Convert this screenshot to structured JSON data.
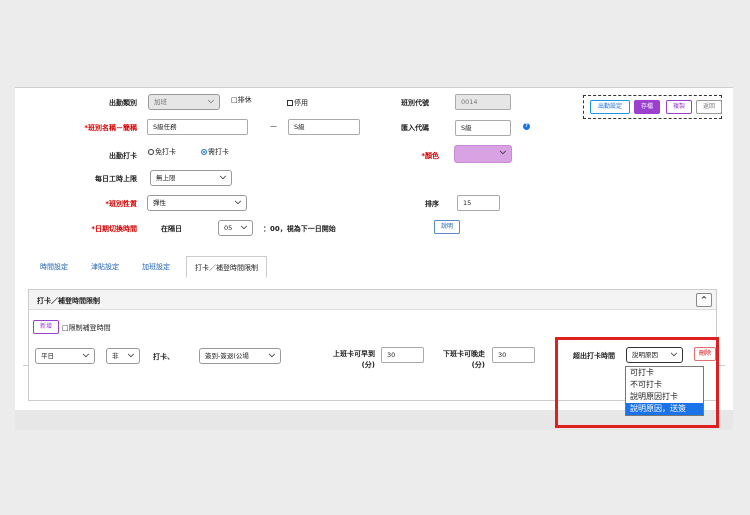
{
  "form": {
    "attend_type_label": "出勤類別",
    "attend_type_value": "加班",
    "rest_label": "□排休",
    "disable_label": "停用",
    "shift_code_label": "班別代號",
    "shift_code_value": "0014",
    "shift_name_label": "*班別名稱－簡稱",
    "shift_name_value": "S級任務",
    "dash": "—",
    "shift_short_value": "S級",
    "import_code_label": "匯入代碼",
    "import_code_value": "S級",
    "punch_label": "出勤打卡",
    "punch_opt_free": "免打卡",
    "punch_opt_need": "需打卡",
    "color_label": "*顏色",
    "daily_hours_label": "每日工時上限",
    "daily_hours_value": "無上限",
    "shift_nature_label": "*班別性質",
    "shift_nature_value": "彈性",
    "sort_label": "排序",
    "sort_value": "15",
    "day_switch_label": "*日期切換時間",
    "day_switch_prefix": "在隔日",
    "day_switch_hour": "05",
    "day_switch_suffix": "：00，視為下一日開始",
    "explain_button": "說明"
  },
  "colors": {
    "swatch": "#d9a3e3",
    "primary": "#9b3fcf",
    "danger": "#d40000"
  },
  "actions": {
    "attend_settings": "出勤設定",
    "save": "存檔",
    "copy": "複製",
    "back": "返回"
  },
  "tabs": [
    "時間設定",
    "津貼設定",
    "加班設定",
    "打卡／補登時間限制"
  ],
  "section": {
    "title": "打卡／補登時間限制",
    "add_button": "新增",
    "limit_checkbox": "□限制補登時間",
    "day_select": "平日",
    "sub_select": "非",
    "punch_type": "打卡、",
    "scope_select": "簽到-簽退(公場",
    "early_label": "上班卡可早到",
    "early_unit": "(分)",
    "early_value": "30",
    "late_label": "下班卡可晚走",
    "late_unit": "(分)",
    "late_value": "30",
    "exceed_label": "超出打卡時間",
    "exceed_select": "說明原因",
    "delete_button": "刪除",
    "collapse_icon": "^"
  },
  "dropdown": {
    "options": [
      "可打卡",
      "不可打卡",
      "說明原因打卡",
      "說明原因，送簽"
    ],
    "selected_index": 3
  }
}
